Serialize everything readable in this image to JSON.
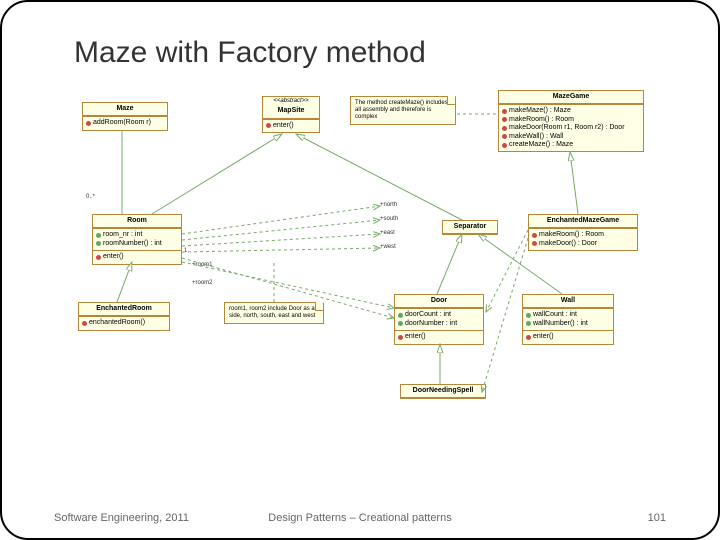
{
  "title": "Maze with Factory method",
  "footer": {
    "left": "Software Engineering, 2011",
    "center": "Design Patterns – Creational patterns",
    "right": "101"
  },
  "classes": {
    "maze": {
      "name": "Maze",
      "ops": [
        "addRoom(Room r)"
      ]
    },
    "mapsite": {
      "stereo": "<<abstract>>",
      "name": "MapSite",
      "ops": [
        "enter()"
      ]
    },
    "mazegame": {
      "name": "MazeGame",
      "ops": [
        "makeMaze() : Maze",
        "makeRoom() : Room",
        "makeDoor(Room r1, Room r2) : Door",
        "makeWall() : Wall",
        "createMaze() : Maze"
      ]
    },
    "room": {
      "name": "Room",
      "attrs": [
        "room_nr : int",
        "roomNumber() : int"
      ],
      "ops": [
        "enter()"
      ]
    },
    "enchantedroom": {
      "name": "EnchantedRoom",
      "ops": [
        "enchantedRoom()"
      ]
    },
    "separator": {
      "name": "Separator"
    },
    "enchantedmazegame": {
      "name": "EnchantedMazeGame",
      "ops": [
        "makeRoom() : Room",
        "makeDoor() : Door"
      ]
    },
    "door": {
      "name": "Door",
      "attrs": [
        "doorCount : int",
        "doorNumber : int"
      ],
      "ops": [
        "enter()"
      ]
    },
    "wall": {
      "name": "Wall",
      "attrs": [
        "wallCount : int",
        "wallNumber() : int"
      ],
      "ops": [
        "enter()"
      ]
    },
    "doorneedingspell": {
      "name": "DoorNeedingSpell"
    }
  },
  "notes": {
    "note1": "The method createMaze() includes all assembly and therefore is complex",
    "note2": "room1, room2 include Door as a side, north, south, east and west"
  },
  "labels": {
    "m_room": "0..*",
    "north": "+north",
    "south": "+south",
    "east": "+east",
    "west": "+west",
    "room1": "+room1",
    "room2": "+room2",
    "one": "1"
  }
}
